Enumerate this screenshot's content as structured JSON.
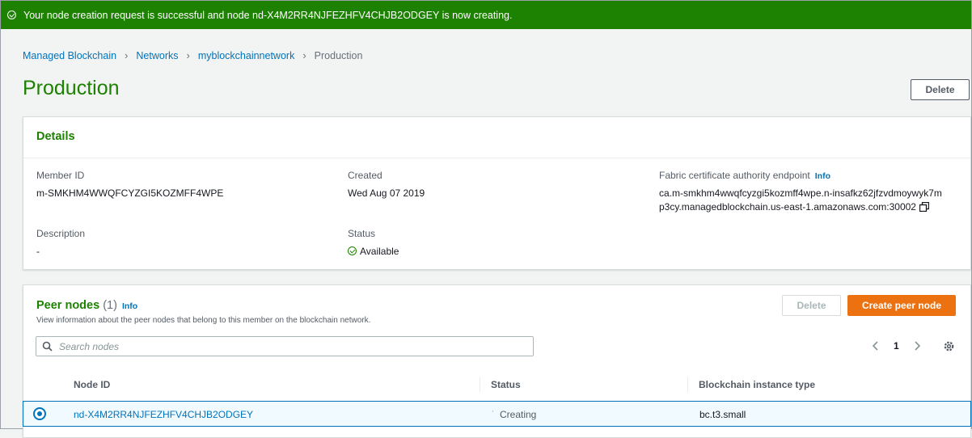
{
  "flash": {
    "message": "Your node creation request is successful and node nd-X4M2RR4NJFEZHFV4CHJB2ODGEY is now creating.",
    "color": "#1d8102"
  },
  "breadcrumb": [
    "Managed Blockchain",
    "Networks",
    "myblockchainnetwork",
    "Production"
  ],
  "page_title": "Production",
  "delete_label": "Delete",
  "details": {
    "heading": "Details",
    "member_id_label": "Member ID",
    "member_id": "m-SMKHM4WWQFCYZGI5KOZMFF4WPE",
    "created_label": "Created",
    "created": "Wed Aug 07 2019",
    "ca_label": "Fabric certificate authority endpoint",
    "info": "Info",
    "ca_line1": "ca.m-smkhm4wwqfcyzgi5kozmff4wpe.n-insafkz62jfzvdmoywyk7m",
    "ca_line2": "p3cy.managedblockchain.us-east-1.amazonaws.com:30002",
    "description_label": "Description",
    "description": "-",
    "status_label": "Status",
    "status": "Available"
  },
  "peers": {
    "heading": "Peer nodes",
    "count": "(1)",
    "info": "Info",
    "subtitle": "View information about the peer nodes that belong to this member on the blockchain network.",
    "delete_label": "Delete",
    "create_label": "Create peer node",
    "search_placeholder": "Search nodes",
    "page": "1",
    "columns": [
      "Node ID",
      "Status",
      "Blockchain instance type"
    ],
    "rows": [
      {
        "node_id": "nd-X4M2RR4NJFEZHFV4CHJB2ODGEY",
        "status": "Creating",
        "instance_type": "bc.t3.small"
      }
    ]
  },
  "colors": {
    "accent": "#ec7211",
    "link": "#0073bb",
    "success": "#1d8102"
  },
  "icons": [
    "success-check-icon",
    "copy-icon",
    "search-icon",
    "chevron-left-icon",
    "chevron-right-icon",
    "settings-gear-icon",
    "radio-selected-icon",
    "loading-spinner-icon"
  ]
}
